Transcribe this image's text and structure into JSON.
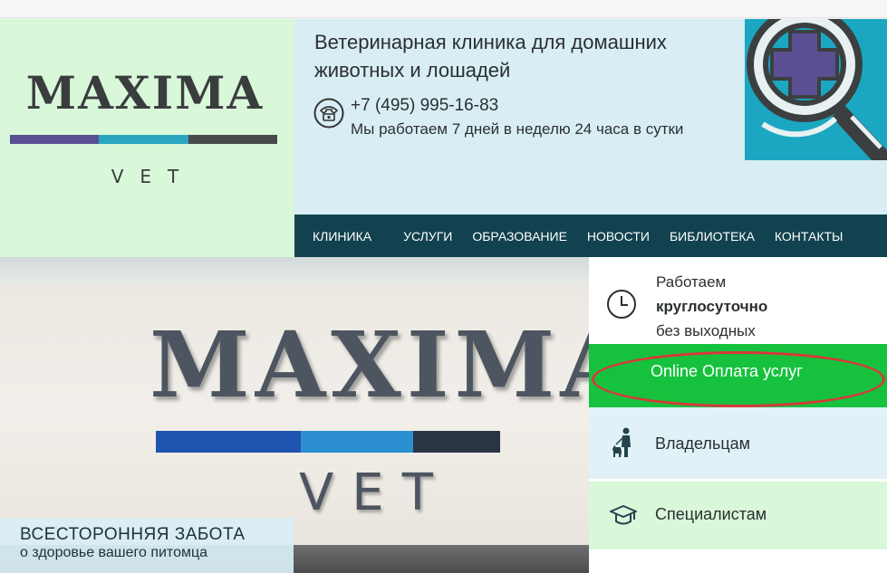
{
  "brand": {
    "logo_word": "MAXIMA",
    "logo_sub": "VET",
    "bar_colors": [
      "#5a4f92",
      "#2aa6bf",
      "#474a4b"
    ]
  },
  "header": {
    "tagline": "Ветеринарная клиника для домашних животных и лошадей",
    "phone": "+7 (495) 995-16-83",
    "hours": "Мы работаем 7 дней в неделю 24 часа в сутки",
    "phone_icon": "telephone-icon",
    "emblem_icon": "medical-cross-magnifier-icon",
    "background": "#d8eef4"
  },
  "nav": {
    "items": [
      {
        "label": "КЛИНИКА"
      },
      {
        "label": "УСЛУГИ"
      },
      {
        "label": "ОБРАЗОВАНИЕ"
      },
      {
        "label": "НОВОСТИ"
      },
      {
        "label": "БИБЛИОТЕКА"
      },
      {
        "label": "КОНТАКТЫ"
      }
    ],
    "background": "#12424f"
  },
  "hero": {
    "sign_word": "MAXIMA",
    "sign_sub": "VET",
    "caption_title": "ВСЕСТОРОННЯЯ ЗАБОТА",
    "caption_subtitle": "о здоровье вашего питомца"
  },
  "side": {
    "hours_line1": "Работаем",
    "hours_line2": "круглосуточно",
    "hours_line3": "без выходных",
    "clock_icon": "clock-icon",
    "pay_label": "Online Оплата услуг",
    "pay_color": "#16c23d",
    "highlight_color": "#d8383a",
    "owners_label": "Владельцам",
    "owners_icon": "person-with-dog-icon",
    "specialists_label": "Специалистам",
    "specialists_icon": "graduation-cap-icon"
  }
}
